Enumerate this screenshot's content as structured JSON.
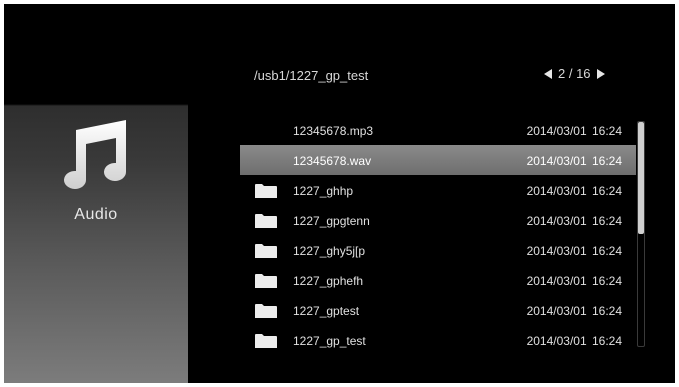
{
  "sidebar": {
    "label": "Audio",
    "icon": "music-note-icon"
  },
  "header": {
    "path": "/usb1/1227_gp_test",
    "pager": {
      "text": "2 / 16",
      "current": 2,
      "total": 16
    }
  },
  "files": [
    {
      "type": "file",
      "name": "12345678.mp3",
      "date": "2014/03/01 16:24",
      "selected": false
    },
    {
      "type": "file",
      "name": "12345678.wav",
      "date": "2014/03/01 16:24",
      "selected": true
    },
    {
      "type": "folder",
      "name": "1227_ghhp",
      "date": "2014/03/01 16:24",
      "selected": false
    },
    {
      "type": "folder",
      "name": "1227_gpgtenn",
      "date": "2014/03/01 16:24",
      "selected": false
    },
    {
      "type": "folder",
      "name": "1227_ghy5j[p",
      "date": "2014/03/01 16:24",
      "selected": false
    },
    {
      "type": "folder",
      "name": "1227_gphefh",
      "date": "2014/03/01 16:24",
      "selected": false
    },
    {
      "type": "folder",
      "name": "1227_gptest",
      "date": "2014/03/01 16:24",
      "selected": false
    },
    {
      "type": "folder",
      "name": "1227_gp_test",
      "date": "2014/03/01 16:24",
      "selected": false
    }
  ],
  "scroll": {
    "position_fraction": 0.0,
    "visible_fraction": 0.5
  },
  "colors": {
    "background": "#000000",
    "selection": "#7c7c7c",
    "text": "#e0e0e0"
  }
}
